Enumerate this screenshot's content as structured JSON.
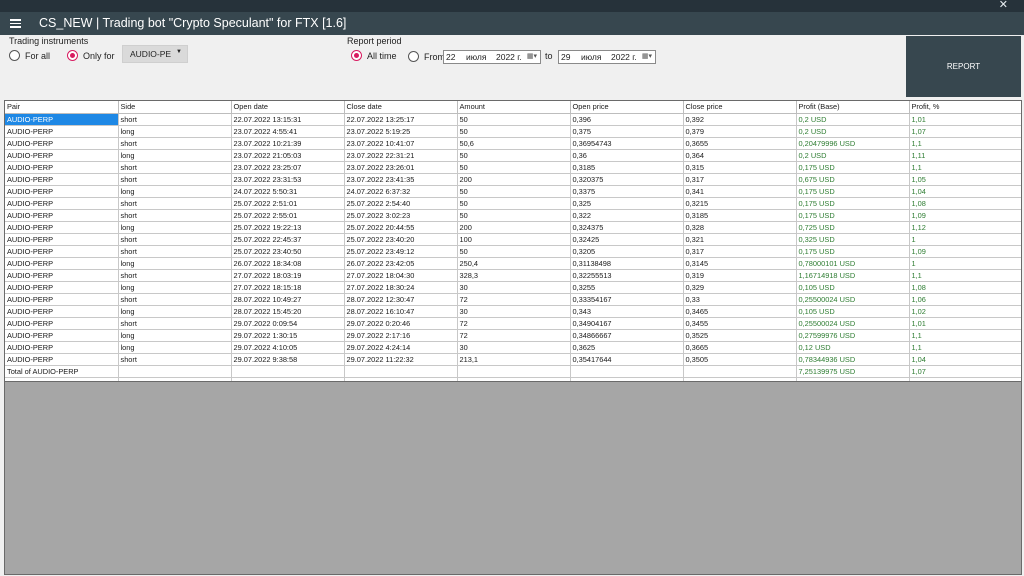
{
  "window": {
    "close_glyph": "✕"
  },
  "header": {
    "title": "CS_NEW |  Trading bot \"Crypto Speculant\" for FTX [1.6]",
    "menu_icon": "hamburger-menu-icon"
  },
  "instruments": {
    "label": "Trading instruments",
    "for_all": "For all",
    "only_for": "Only for",
    "selected": "only_for",
    "combo_value": "AUDIO-PE",
    "combo_arrow": "▼"
  },
  "period": {
    "label": "Report period",
    "all_time": "All time",
    "from": "From",
    "selected": "all_time",
    "from_day": "22",
    "from_month": "июля",
    "from_year": "2022 г.",
    "to": "to",
    "to_day": "29",
    "to_month": "июля",
    "to_year": "2022 г.",
    "calendar_icon": "calendar-icon"
  },
  "report_button": "REPORT",
  "accent_color": "#d81b60",
  "header_color": "#37474f",
  "profit_color": "#2e7d32",
  "table": {
    "columns": [
      "Pair",
      "Side",
      "Open date",
      "Close date",
      "Amount",
      "Open price",
      "Close price",
      "Profit (Base)",
      "Profit, %"
    ],
    "rows": [
      [
        "AUDIO-PERP",
        "short",
        "22.07.2022 13:15:31",
        "22.07.2022 13:25:17",
        "50",
        "0,396",
        "0,392",
        "0,2 USD",
        "1,01"
      ],
      [
        "AUDIO-PERP",
        "long",
        "23.07.2022 4:55:41",
        "23.07.2022 5:19:25",
        "50",
        "0,375",
        "0,379",
        "0,2 USD",
        "1,07"
      ],
      [
        "AUDIO-PERP",
        "short",
        "23.07.2022 10:21:39",
        "23.07.2022 10:41:07",
        "50,6",
        "0,36954743",
        "0,3655",
        "0,20479996 USD",
        "1,1"
      ],
      [
        "AUDIO-PERP",
        "long",
        "23.07.2022 21:05:03",
        "23.07.2022 22:31:21",
        "50",
        "0,36",
        "0,364",
        "0,2 USD",
        "1,11"
      ],
      [
        "AUDIO-PERP",
        "short",
        "23.07.2022 23:25:07",
        "23.07.2022 23:26:01",
        "50",
        "0,3185",
        "0,315",
        "0,175 USD",
        "1,1"
      ],
      [
        "AUDIO-PERP",
        "short",
        "23.07.2022 23:31:53",
        "23.07.2022 23:41:35",
        "200",
        "0,320375",
        "0,317",
        "0,675 USD",
        "1,05"
      ],
      [
        "AUDIO-PERP",
        "long",
        "24.07.2022 5:50:31",
        "24.07.2022 6:37:32",
        "50",
        "0,3375",
        "0,341",
        "0,175 USD",
        "1,04"
      ],
      [
        "AUDIO-PERP",
        "short",
        "25.07.2022 2:51:01",
        "25.07.2022 2:54:40",
        "50",
        "0,325",
        "0,3215",
        "0,175 USD",
        "1,08"
      ],
      [
        "AUDIO-PERP",
        "short",
        "25.07.2022 2:55:01",
        "25.07.2022 3:02:23",
        "50",
        "0,322",
        "0,3185",
        "0,175 USD",
        "1,09"
      ],
      [
        "AUDIO-PERP",
        "long",
        "25.07.2022 19:22:13",
        "25.07.2022 20:44:55",
        "200",
        "0,324375",
        "0,328",
        "0,725 USD",
        "1,12"
      ],
      [
        "AUDIO-PERP",
        "short",
        "25.07.2022 22:45:37",
        "25.07.2022 23:40:20",
        "100",
        "0,32425",
        "0,321",
        "0,325 USD",
        "1"
      ],
      [
        "AUDIO-PERP",
        "short",
        "25.07.2022 23:40:50",
        "25.07.2022 23:49:12",
        "50",
        "0,3205",
        "0,317",
        "0,175 USD",
        "1,09"
      ],
      [
        "AUDIO-PERP",
        "long",
        "26.07.2022 18:34:08",
        "26.07.2022 23:42:05",
        "250,4",
        "0,31138498",
        "0,3145",
        "0,78000101 USD",
        "1"
      ],
      [
        "AUDIO-PERP",
        "short",
        "27.07.2022 18:03:19",
        "27.07.2022 18:04:30",
        "328,3",
        "0,32255513",
        "0,319",
        "1,16714918 USD",
        "1,1"
      ],
      [
        "AUDIO-PERP",
        "long",
        "27.07.2022 18:15:18",
        "27.07.2022 18:30:24",
        "30",
        "0,3255",
        "0,329",
        "0,105 USD",
        "1,08"
      ],
      [
        "AUDIO-PERP",
        "short",
        "28.07.2022 10:49:27",
        "28.07.2022 12:30:47",
        "72",
        "0,33354167",
        "0,33",
        "0,25500024 USD",
        "1,06"
      ],
      [
        "AUDIO-PERP",
        "long",
        "28.07.2022 15:45:20",
        "28.07.2022 16:10:47",
        "30",
        "0,343",
        "0,3465",
        "0,105 USD",
        "1,02"
      ],
      [
        "AUDIO-PERP",
        "short",
        "29.07.2022 0:09:54",
        "29.07.2022 0:20:46",
        "72",
        "0,34904167",
        "0,3455",
        "0,25500024 USD",
        "1,01"
      ],
      [
        "AUDIO-PERP",
        "long",
        "29.07.2022 1:30:15",
        "29.07.2022 2:17:16",
        "72",
        "0,34866667",
        "0,3525",
        "0,27599976 USD",
        "1,1"
      ],
      [
        "AUDIO-PERP",
        "long",
        "29.07.2022 4:10:05",
        "29.07.2022 4:24:14",
        "30",
        "0,3625",
        "0,3665",
        "0,12 USD",
        "1,1"
      ],
      [
        "AUDIO-PERP",
        "short",
        "29.07.2022 9:38:58",
        "29.07.2022 11:22:32",
        "213,1",
        "0,35417644",
        "0,3505",
        "0,78344936 USD",
        "1,04"
      ]
    ],
    "total": [
      "Total of AUDIO-PERP",
      "",
      "",
      "",
      "",
      "",
      "",
      "7,25139975 USD",
      "1,07"
    ]
  }
}
